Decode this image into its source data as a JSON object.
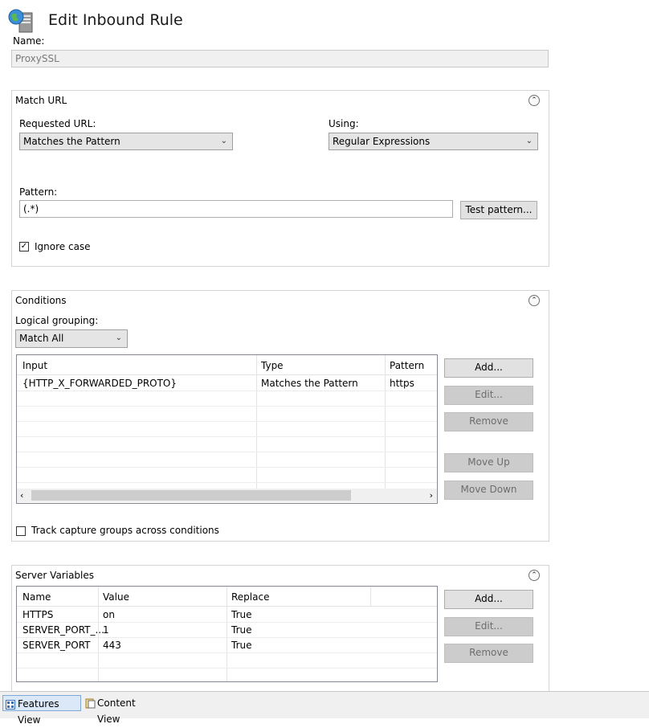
{
  "header": {
    "title": "Edit Inbound Rule",
    "icon": "server-globe-icon"
  },
  "name_field": {
    "label": "Name:",
    "value": "ProxySSL"
  },
  "match_url": {
    "title": "Match URL",
    "requested_url_label": "Requested URL:",
    "requested_url_value": "Matches the Pattern",
    "using_label": "Using:",
    "using_value": "Regular Expressions",
    "pattern_label": "Pattern:",
    "pattern_value": "(.*)",
    "test_pattern_button": "Test pattern...",
    "ignore_case_label": "Ignore case",
    "ignore_case_checked": true
  },
  "conditions": {
    "title": "Conditions",
    "logical_grouping_label": "Logical grouping:",
    "logical_grouping_value": "Match All",
    "columns": [
      "Input",
      "Type",
      "Pattern"
    ],
    "rows": [
      [
        "{HTTP_X_FORWARDED_PROTO}",
        "Matches the Pattern",
        "https"
      ]
    ],
    "buttons": {
      "add": "Add...",
      "edit": "Edit...",
      "remove": "Remove",
      "move_up": "Move Up",
      "move_down": "Move Down"
    },
    "track_capture_label": "Track capture groups across conditions",
    "track_capture_checked": false
  },
  "server_variables": {
    "title": "Server Variables",
    "columns": [
      "Name",
      "Value",
      "Replace"
    ],
    "rows": [
      [
        "HTTPS",
        "on",
        "True"
      ],
      [
        "SERVER_PORT_...",
        "1",
        "True"
      ],
      [
        "SERVER_PORT",
        "443",
        "True"
      ]
    ],
    "buttons": {
      "add": "Add...",
      "edit": "Edit...",
      "remove": "Remove"
    }
  },
  "status_bar": {
    "features_view": "Features View",
    "content_view": "Content View"
  }
}
